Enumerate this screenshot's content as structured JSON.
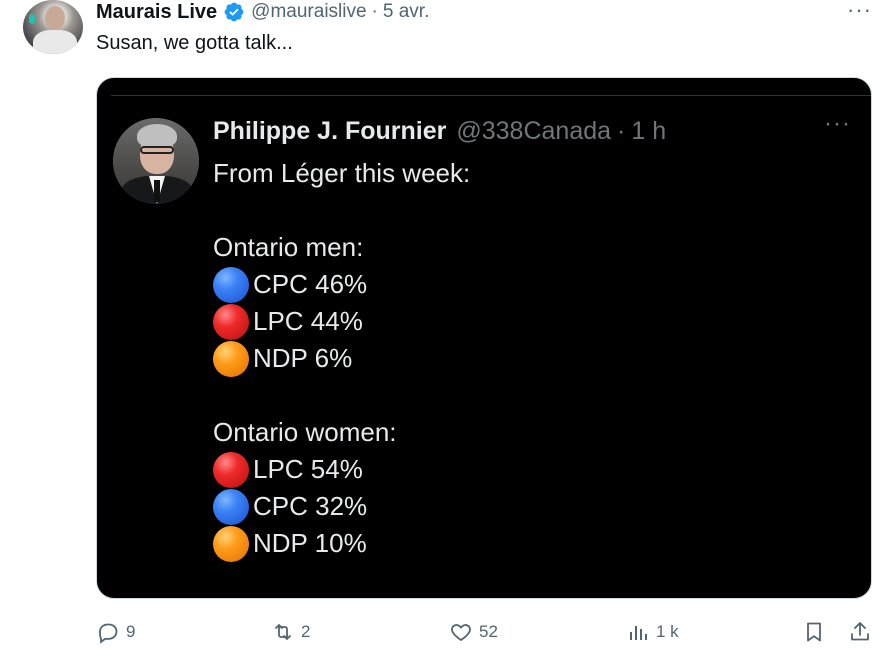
{
  "author": {
    "name": "Maurais Live",
    "handle": "@mauraislive",
    "time": "5 avr.",
    "verified_color": "#1d9bf0"
  },
  "tweet_text": "Susan, we gotta talk...",
  "quoted": {
    "name": "Philippe J. Fournier",
    "handle": "@338Canada",
    "time": "1 h",
    "intro": "From Léger this week:",
    "sections": [
      {
        "title": "Ontario men:",
        "rows": [
          {
            "icon": "blue-circle-icon",
            "text": "CPC 46%",
            "color": "blue"
          },
          {
            "icon": "red-circle-icon",
            "text": "LPC 44%",
            "color": "red"
          },
          {
            "icon": "orange-circle-icon",
            "text": "NDP 6%",
            "color": "orange"
          }
        ]
      },
      {
        "title": "Ontario women:",
        "rows": [
          {
            "icon": "red-circle-icon",
            "text": "LPC 54%",
            "color": "red"
          },
          {
            "icon": "blue-circle-icon",
            "text": "CPC 32%",
            "color": "blue"
          },
          {
            "icon": "orange-circle-icon",
            "text": "NDP 10%",
            "color": "orange"
          }
        ]
      }
    ]
  },
  "actions": {
    "replies": "9",
    "retweets": "2",
    "likes": "52",
    "views": "1 k"
  },
  "colors": {
    "text_primary": "#0f1419",
    "text_secondary": "#536471",
    "media_bg": "#000000"
  }
}
